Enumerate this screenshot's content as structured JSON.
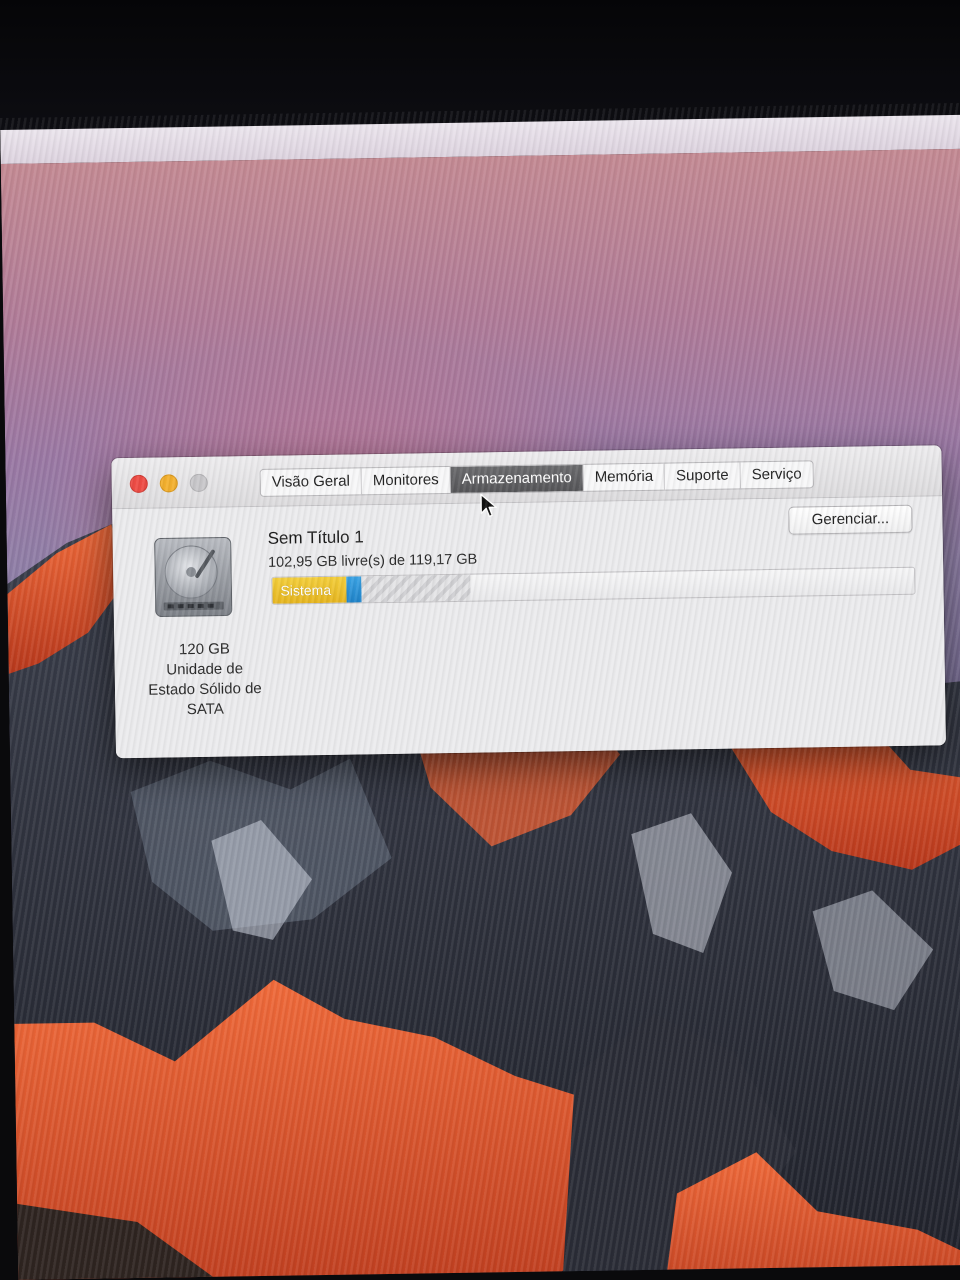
{
  "tabs": [
    {
      "label": "Visão Geral",
      "active": false
    },
    {
      "label": "Monitores",
      "active": false
    },
    {
      "label": "Armazenamento",
      "active": true
    },
    {
      "label": "Memória",
      "active": false
    },
    {
      "label": "Suporte",
      "active": false
    },
    {
      "label": "Serviço",
      "active": false
    }
  ],
  "disk": {
    "icon": "hard-drive-icon",
    "capacity": "120 GB",
    "type_line1": "Unidade de",
    "type_line2": "Estado Sólido de",
    "type_line3": "SATA"
  },
  "volume": {
    "name": "Sem Título 1",
    "free_text": "102,95 GB livre(s) de 119,17 GB"
  },
  "actions": {
    "manage_label": "Gerenciar..."
  },
  "storage_bar": {
    "total_gb": 119.17,
    "segments": [
      {
        "name": "Sistema",
        "kind": "system",
        "fraction": 0.115,
        "color": "#e9b824"
      },
      {
        "name": "",
        "kind": "other",
        "fraction": 0.023,
        "color": "#2b93d8"
      },
      {
        "name": "",
        "kind": "purgeable",
        "fraction": 0.17,
        "color": "#d6d6d8"
      }
    ]
  },
  "colors": {
    "close": "#ee4c45",
    "minimize": "#f3b02e",
    "zoom": "#c8c7ca",
    "active_tab": "#5e5e61"
  }
}
